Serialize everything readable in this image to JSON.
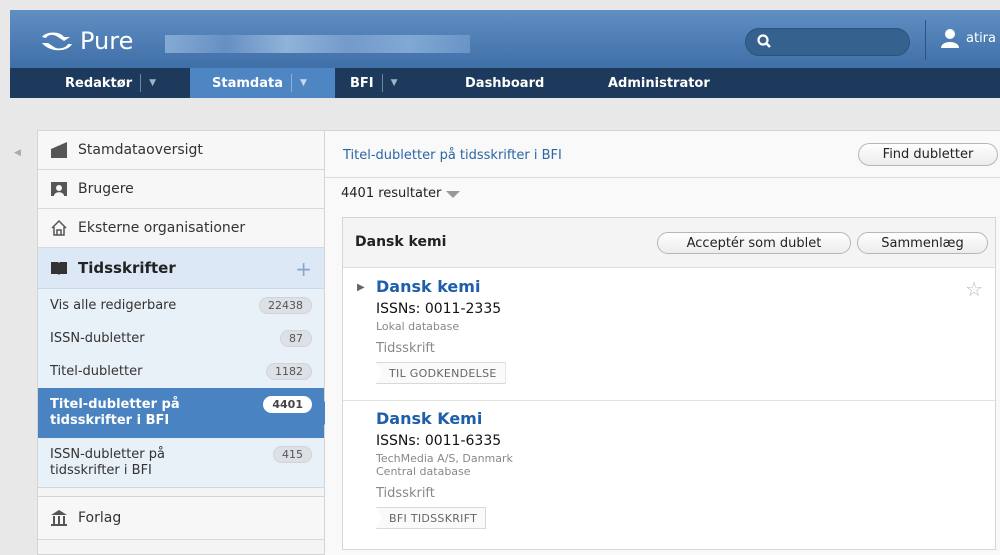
{
  "header": {
    "logo_text": "Pure",
    "user_name": "atira"
  },
  "nav": {
    "items": [
      {
        "label": "Redaktør",
        "dropdown": true
      },
      {
        "label": "Stamdata",
        "dropdown": true,
        "active": true
      },
      {
        "label": "BFI",
        "dropdown": true
      },
      {
        "label": "Dashboard"
      },
      {
        "label": "Administrator"
      }
    ]
  },
  "sidebar": {
    "items": [
      {
        "label": "Stamdataoversigt",
        "icon": "overview-icon"
      },
      {
        "label": "Brugere",
        "icon": "user-icon"
      },
      {
        "label": "Eksterne organisationer",
        "icon": "house-icon"
      }
    ],
    "section": {
      "label": "Tidsskrifter",
      "icon": "book-icon"
    },
    "sub_items": [
      {
        "label": "Vis alle redigerbare",
        "count": "22438"
      },
      {
        "label": "ISSN-dubletter",
        "count": "87"
      },
      {
        "label": "Titel-dubletter",
        "count": "1182"
      },
      {
        "label": "Titel-dubletter på tidsskrifter i BFI",
        "count": "4401",
        "active": true
      },
      {
        "label": "ISSN-dubletter på tidsskrifter i BFI",
        "count": "415"
      }
    ],
    "bottom_item": {
      "label": "Forlag",
      "icon": "building-icon"
    }
  },
  "main": {
    "breadcrumb": "Titel-dubletter på tidsskrifter i BFI",
    "find_button": "Find dubletter",
    "results": "4401 resultater",
    "card": {
      "title": "Dansk kemi",
      "accept_button": "Acceptér som dublet",
      "merge_button": "Sammenlæg",
      "entries": [
        {
          "title": "Dansk kemi",
          "issn": "ISSNs: 0011-2335",
          "meta": [
            "Lokal database"
          ],
          "type": "Tidsskrift",
          "status": "TIL GODKENDELSE"
        },
        {
          "title": "Dansk Kemi",
          "issn": "ISSNs: 0011-6335",
          "meta": [
            "TechMedia A/S, Danmark",
            "Central database"
          ],
          "type": "Tidsskrift",
          "status": "BFI TIDSSKRIFT"
        }
      ]
    }
  }
}
